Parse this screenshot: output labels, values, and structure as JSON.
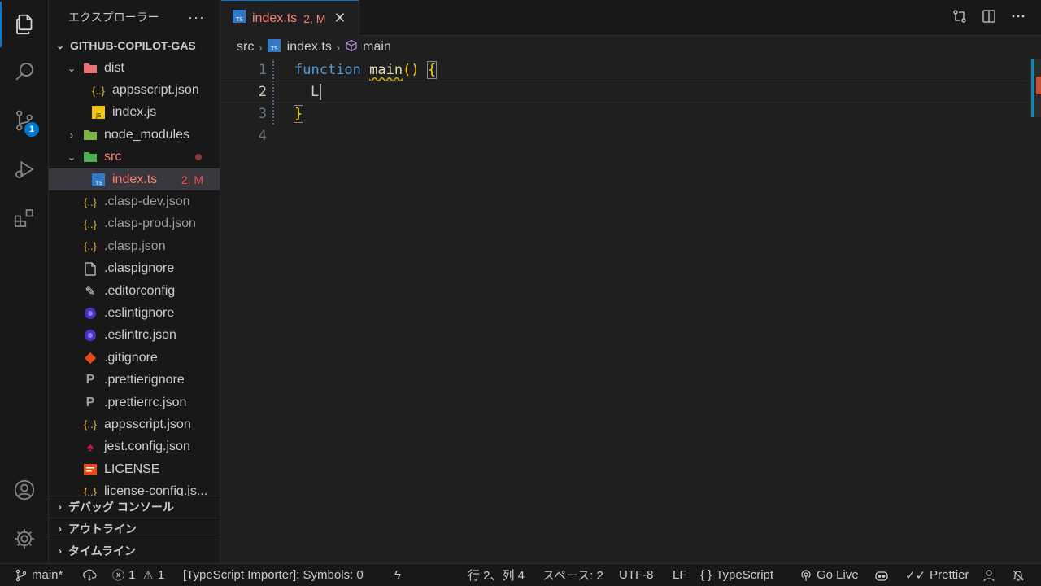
{
  "sidebar": {
    "title": "エクスプローラー",
    "more": "···",
    "folder": "GITHUB-COPILOT-GAS",
    "items": [
      {
        "label": "dist"
      },
      {
        "label": "appsscript.json"
      },
      {
        "label": "index.js"
      },
      {
        "label": "node_modules"
      },
      {
        "label": "src"
      },
      {
        "label": "index.ts",
        "status": "2, M"
      },
      {
        "label": ".clasp-dev.json"
      },
      {
        "label": ".clasp-prod.json"
      },
      {
        "label": ".clasp.json"
      },
      {
        "label": ".claspignore"
      },
      {
        "label": ".editorconfig"
      },
      {
        "label": ".eslintignore"
      },
      {
        "label": ".eslintrc.json"
      },
      {
        "label": ".gitignore"
      },
      {
        "label": ".prettierignore"
      },
      {
        "label": ".prettierrc.json"
      },
      {
        "label": "appsscript.json"
      },
      {
        "label": "jest.config.json"
      },
      {
        "label": "LICENSE"
      },
      {
        "label": "license-config.js..."
      }
    ],
    "sections": [
      "デバッグ コンソール",
      "アウトライン",
      "タイムライン"
    ]
  },
  "activity": {
    "scm_badge": "1"
  },
  "tab": {
    "name": "index.ts",
    "status": "2, M",
    "close": "✕",
    "icon": "TS"
  },
  "breadcrumb": {
    "folder": "src",
    "file": "index.ts",
    "symbol": "main"
  },
  "editor": {
    "lines": [
      {
        "number": "1",
        "keyword": "function",
        "name": "main",
        "parens": "()",
        "brace": "{"
      },
      {
        "number": "2",
        "text": "L"
      },
      {
        "number": "3",
        "brace": "}"
      },
      {
        "number": "4"
      }
    ]
  },
  "statusbar": {
    "branch": "main*",
    "errors": "1",
    "warnings": "1",
    "importer": "[TypeScript Importer]: Symbols: 0",
    "position": "行 2、列 4",
    "spaces": "スペース: 2",
    "encoding": "UTF-8",
    "eol": "LF",
    "language_braces": "{ }",
    "language": "TypeScript",
    "golive": "Go Live",
    "prettier": "Prettier"
  },
  "colors": {
    "accent": "#0078d4",
    "modified": "#f88070",
    "keyword": "#569cd6",
    "function": "#dcdcaa",
    "bracket": "#ffd700"
  }
}
